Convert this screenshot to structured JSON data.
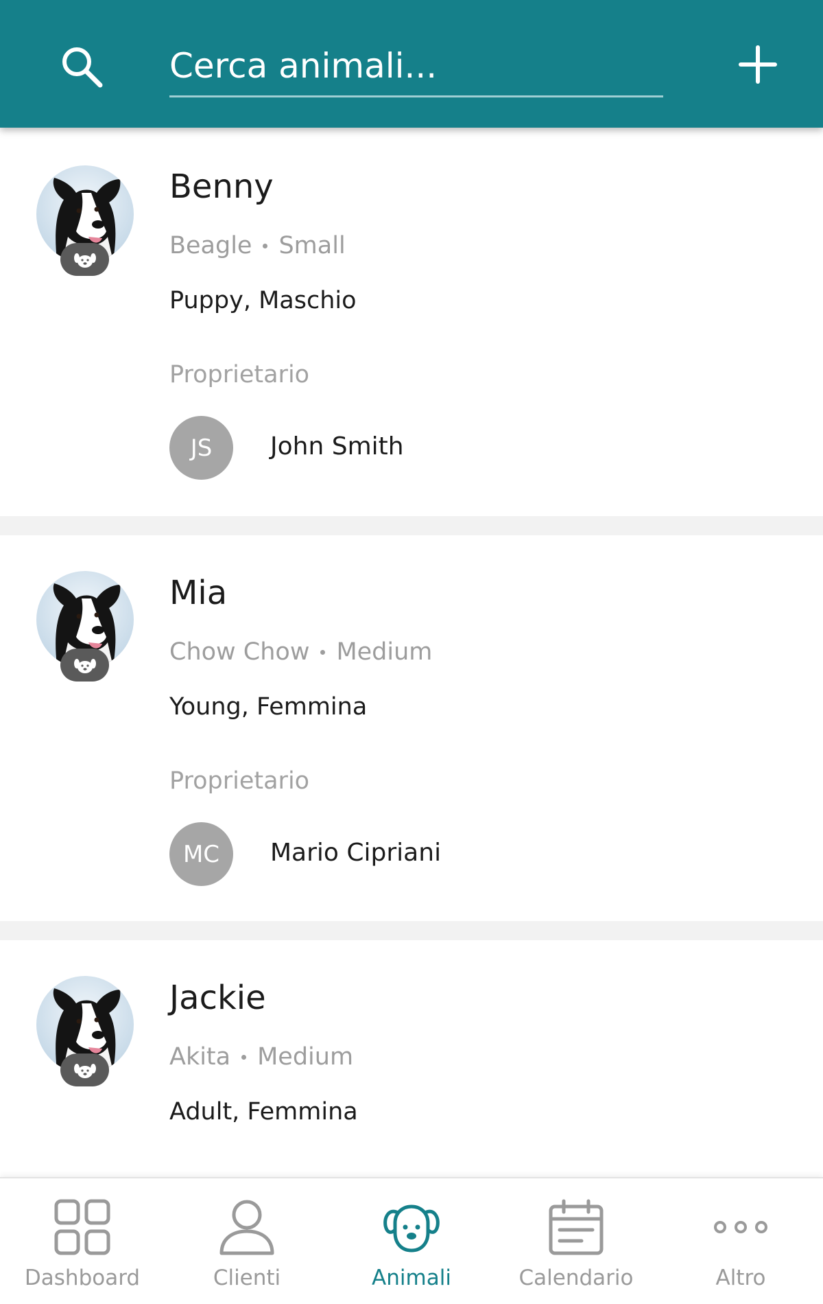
{
  "header": {
    "search_placeholder": "Cerca animali...",
    "search_icon": "search-icon",
    "add_icon": "plus-icon"
  },
  "pets": [
    {
      "name": "Benny",
      "breed": "Beagle",
      "size": "Small",
      "details": "Puppy, Maschio",
      "owner_label": "Proprietario",
      "owner_initials": "JS",
      "owner_name": "John Smith"
    },
    {
      "name": "Mia",
      "breed": "Chow Chow",
      "size": "Medium",
      "details": "Young, Femmina",
      "owner_label": "Proprietario",
      "owner_initials": "MC",
      "owner_name": "Mario Cipriani"
    },
    {
      "name": "Jackie",
      "breed": "Akita",
      "size": "Medium",
      "details": "Adult, Femmina"
    }
  ],
  "nav": {
    "items": [
      {
        "label": "Dashboard",
        "icon": "grid-icon"
      },
      {
        "label": "Clienti",
        "icon": "person-icon"
      },
      {
        "label": "Animali",
        "icon": "dog-icon",
        "active": true
      },
      {
        "label": "Calendario",
        "icon": "calendar-icon"
      },
      {
        "label": "Altro",
        "icon": "more-icon"
      }
    ]
  },
  "colors": {
    "primary": "#15808a",
    "avatar_gray": "#a6a6a6",
    "muted_text": "#9d9d9d"
  }
}
